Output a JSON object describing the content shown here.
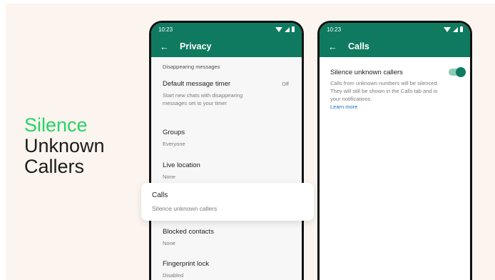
{
  "headline": {
    "line1": "Silence",
    "line2": "Unknown",
    "line3": "Callers",
    "accent_color": "#25d366"
  },
  "status_bar": {
    "time": "10:23"
  },
  "colors": {
    "app_bar": "#0f7a5f",
    "background": "#fcf5ef",
    "toggle_on": "#0f7a5f",
    "link": "#1a73b5"
  },
  "privacy_screen": {
    "title": "Privacy",
    "back_icon": "arrow-left-icon",
    "section_label": "Disappearing messages",
    "items": [
      {
        "label": "Default message timer",
        "sub": "Start new chats with disappearing messages set to your timer",
        "value": "Off"
      },
      {
        "label": "Groups",
        "sub": "Everyone"
      },
      {
        "label": "Live location",
        "sub": "None"
      },
      {
        "label": "Calls",
        "sub": "Silence unknown callers"
      },
      {
        "label": "Blocked contacts",
        "sub": "None"
      },
      {
        "label": "Fingerprint lock",
        "sub": "Disabled"
      }
    ]
  },
  "calls_screen": {
    "title": "Calls",
    "back_icon": "arrow-left-icon",
    "setting": {
      "label": "Silence unknown callers",
      "description": "Calls from unknown numbers will be silenced. They will still be shown in the Calls tab and in your notifications.",
      "link": "Learn more",
      "enabled": true
    }
  }
}
